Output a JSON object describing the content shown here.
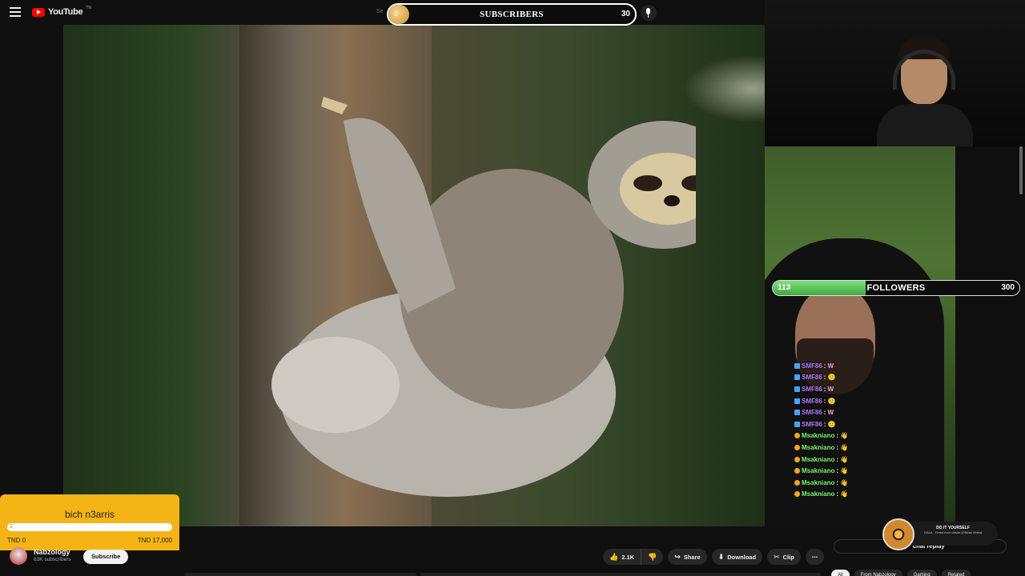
{
  "app": {
    "logo_text": "YouTube",
    "logo_region": "TN",
    "search_placeholder_partial": "Se"
  },
  "subscriber_goal": {
    "current": "0",
    "label": "SUBSCRIBERS",
    "target": "30"
  },
  "follower_goal": {
    "current": "113",
    "label": "FOLLOWERS",
    "target": "300",
    "progress_fraction": 0.377
  },
  "chat": {
    "messages": [
      {
        "user": "SMF86",
        "color": "#b57bff",
        "badge": "blue",
        "emote": "W"
      },
      {
        "user": "SMF86",
        "color": "#b57bff",
        "badge": "blue",
        "emote": "🙂"
      },
      {
        "user": "SMF86",
        "color": "#b57bff",
        "badge": "blue",
        "emote": "W"
      },
      {
        "user": "SMF86",
        "color": "#b57bff",
        "badge": "blue",
        "emote": "🙂"
      },
      {
        "user": "SMF86",
        "color": "#b57bff",
        "badge": "blue",
        "emote": "W"
      },
      {
        "user": "SMF86",
        "color": "#b57bff",
        "badge": "blue",
        "emote": "🙂"
      },
      {
        "user": "Msakniano",
        "color": "#7dff6e",
        "badge": "gold",
        "emote": "👋"
      },
      {
        "user": "Msakniano",
        "color": "#7dff6e",
        "badge": "gold",
        "emote": "👋"
      },
      {
        "user": "Msakniano",
        "color": "#7dff6e",
        "badge": "gold",
        "emote": "👋"
      },
      {
        "user": "Msakniano",
        "color": "#7dff6e",
        "badge": "gold",
        "emote": "👋"
      },
      {
        "user": "Msakniano",
        "color": "#7dff6e",
        "badge": "gold",
        "emote": "👋"
      },
      {
        "user": "Msakniano",
        "color": "#7dff6e",
        "badge": "gold",
        "emote": "👋"
      }
    ]
  },
  "donation": {
    "title": "bich n3arris",
    "bar_value": "2",
    "start": "TND 0",
    "end": "TND 17,000"
  },
  "channel": {
    "name": "Nabzology",
    "subscribers": "63K subscribers",
    "subscribe_label": "Subscribe"
  },
  "actions": {
    "likes": "2.1K",
    "share": "Share",
    "download": "Download",
    "clip": "Clip",
    "more": "⋯"
  },
  "now_playing": {
    "title": "DO IT YOURSELF",
    "subtitle": "GALA - Freed from desire [Official Video]"
  },
  "chat_replay_label": "chat replay",
  "chips": [
    "All",
    "From Nabzology",
    "Gaming",
    "Related"
  ],
  "colors": {
    "accent_red": "#ff0000",
    "donation_yellow": "#f5b416",
    "follower_green": "#5cc85c",
    "page_bg": "#0f0f0f"
  }
}
